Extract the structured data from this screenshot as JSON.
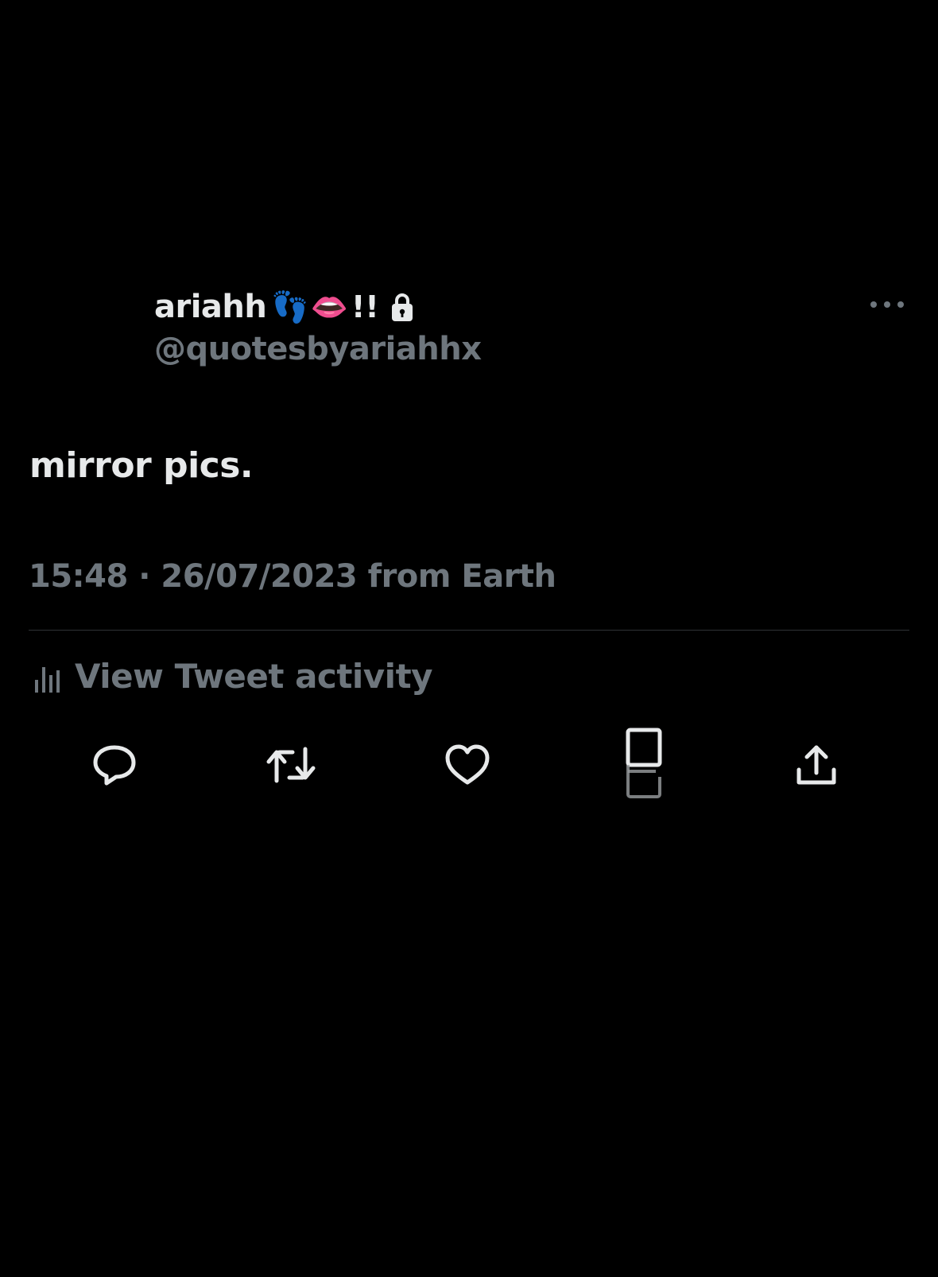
{
  "tweet": {
    "author": {
      "display_name": "ariahh",
      "name_emoji": [
        "👣",
        "👄"
      ],
      "name_suffix": "!!",
      "handle": "@quotesbyariahhx",
      "lock_icon": "lock-icon"
    },
    "text": "mirror pics.",
    "timestamp": "15:48 · 26/07/2023 from Earth",
    "activity_label": "View Tweet activity"
  },
  "actions": {
    "reply": "reply-icon",
    "retweet": "retweet-icon",
    "like": "heart-icon",
    "bookmark": "bookmark-icon",
    "share": "share-icon",
    "more": "more-icon"
  },
  "colors": {
    "background": "#000000",
    "primary_text": "#e7e9ea",
    "secondary_text": "#6e767d",
    "divider": "#2f3336"
  }
}
